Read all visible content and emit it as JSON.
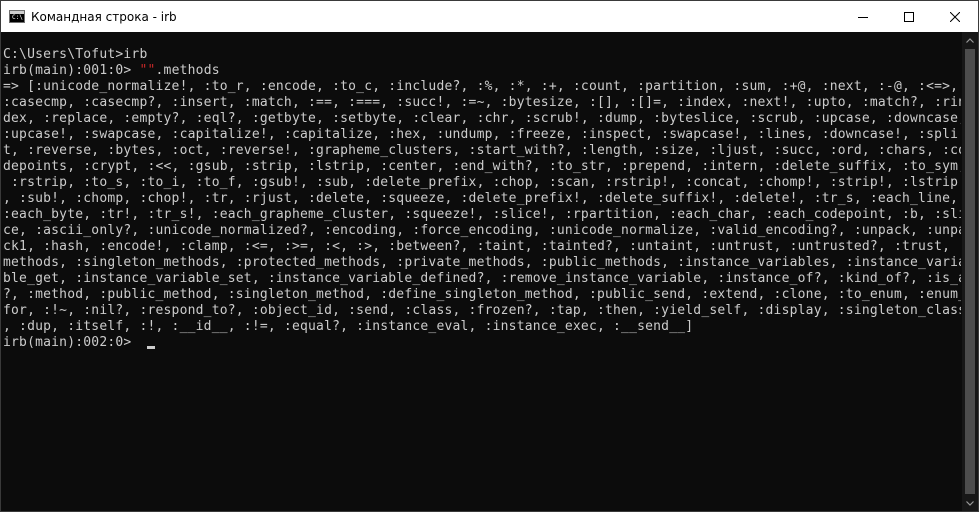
{
  "window": {
    "title": "Командная строка - irb",
    "icon": "cmd-icon",
    "icon_glyph": "C:\\",
    "controls": [
      "minimize-icon",
      "maximize-icon",
      "close-icon"
    ]
  },
  "console": {
    "line_1": "C:\\Users\\Tofut>irb",
    "line_2_prompt": "irb(main):001:0> ",
    "line_2_string": "\"\"",
    "line_2_rest": ".methods",
    "output": [
      "=> [:unicode_normalize!, :to_r, :encode, :to_c, :include?, :%, :*, :+, :count, :partition, :sum, :+@, :next, :-@, :<=>, :<<, :==, :===, :=~",
      ":casecmp, :casecmp?, :insert, :match, :==, :===, :succ!, :=~, :bytesize, :[], :[]=, :index, :next!, :upto, :match?, :rin",
      "dex, :replace, :empty?, :eql?, :getbyte, :setbyte, :clear, :chr, :scrub!, :dump, :byteslice, :scrub, :upcase, :downcase, ",
      ":upcase!, :swapcase, :capitalize!, :capitalize, :hex, :undump, :freeze, :inspect, :swapcase!, :lines, :downcase!, :spli",
      "t, :reverse, :bytes, :oct, :reverse!, :grapheme_clusters, :start_with?, :length, :size, :ljust, :succ, :ord, :chars, :co",
      "depoints, :crypt, :<<, :gsub, :strip, :lstrip, :center, :end_with?, :to_str, :prepend, :intern, :delete_suffix, :to_sym,",
      " :rstrip, :to_s, :to_i, :to_f, :gsub!, :sub, :delete_prefix, :chop, :scan, :rstrip!, :concat, :chomp!, :strip!, :lstrip!",
      ", :sub!, :chomp, :chop!, :tr, :rjust, :delete, :squeeze, :delete_prefix!, :delete_suffix!, :delete!, :tr_s, :each_line, ",
      ":each_byte, :tr!, :tr_s!, :each_grapheme_cluster, :squeeze!, :slice!, :rpartition, :each_char, :each_codepoint, :b, :sli",
      "ce, :ascii_only?, :unicode_normalized?, :encoding, :force_encoding, :unicode_normalize, :valid_encoding?, :unpack, :unpa",
      "ck1, :hash, :encode!, :clamp, :<=, :>=, :<, :>, :between?, :taint, :tainted?, :untaint, :untrust, :untrusted?, :trust, :",
      "methods, :singleton_methods, :protected_methods, :private_methods, :public_methods, :instance_variables, :instance_varia",
      "ble_get, :instance_variable_set, :instance_variable_defined?, :remove_instance_variable, :instance_of?, :kind_of?, :is_a",
      "?, :method, :public_method, :singleton_method, :define_singleton_method, :public_send, :extend, :clone, :to_enum, :enum_",
      "for, :!~, :nil?, :respond_to?, :object_id, :send, :class, :frozen?, :tap, :then, :yield_self, :display, :singleton_class",
      ", :dup, :itself, :!, :__id__, :!=, :equal?, :instance_eval, :instance_exec, :__send__]"
    ],
    "last_prompt": "irb(main):002:0> "
  },
  "colors": {
    "background": "#0c0c0c",
    "text": "#cccccc",
    "string_literal": "#c72828",
    "titlebar": "#ffffff",
    "scrollbar_track": "#171717",
    "scrollbar_thumb": "#4d4d4d"
  }
}
